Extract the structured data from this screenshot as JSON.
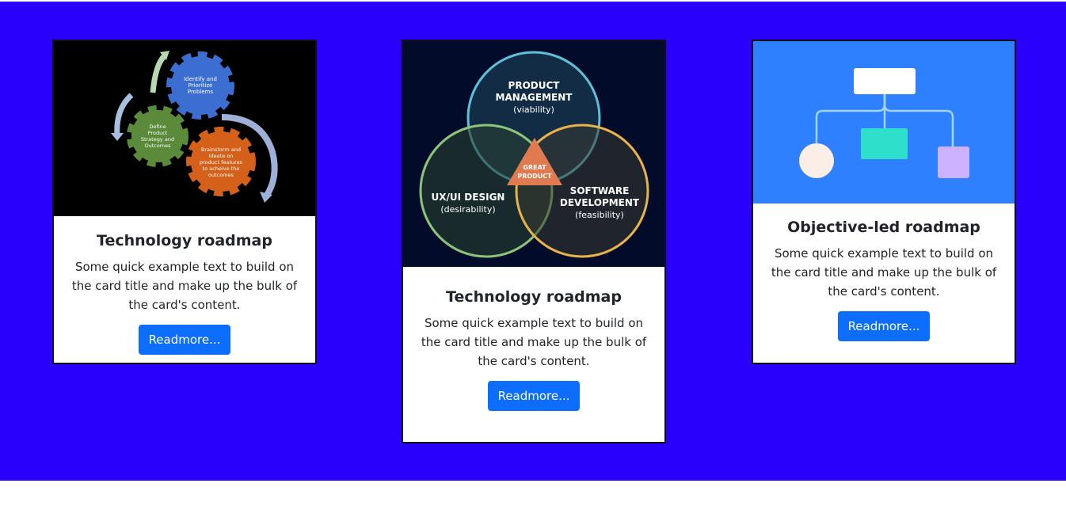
{
  "colors": {
    "background": "#2a00fd",
    "button": "#0d6efd"
  },
  "cards": [
    {
      "title": "Technology roadmap",
      "text": "Some quick example text to build on the card title and make up the bulk of the card's content.",
      "button_label": "Readmore...",
      "image": {
        "gear_top": [
          "Identify and",
          "Prioritize",
          "Problems"
        ],
        "gear_left": [
          "Define",
          "Product",
          "Strategy and",
          "Outcomes"
        ],
        "gear_right": [
          "Brainstorm and",
          "Ideate on",
          "product features",
          "to acheive the",
          "outcomes"
        ]
      }
    },
    {
      "title": "Technology roadmap",
      "text": "Some quick example text to build on the card title and make up the bulk of the card's content.",
      "button_label": "Readmore...",
      "image": {
        "top_circle": [
          "PRODUCT",
          "MANAGEMENT"
        ],
        "top_circle_sub": "(viability)",
        "left_circle": "UX/UI DESIGN",
        "left_circle_sub": "(desirability)",
        "right_circle": [
          "SOFTWARE",
          "DEVELOPMENT"
        ],
        "right_circle_sub": "(feasibility)",
        "center": [
          "GREAT",
          "PRODUCT"
        ]
      }
    },
    {
      "title": "Objective-led roadmap",
      "text": "Some quick example text to build on the card title and make up the bulk of the card's content.",
      "button_label": "Readmore..."
    }
  ]
}
